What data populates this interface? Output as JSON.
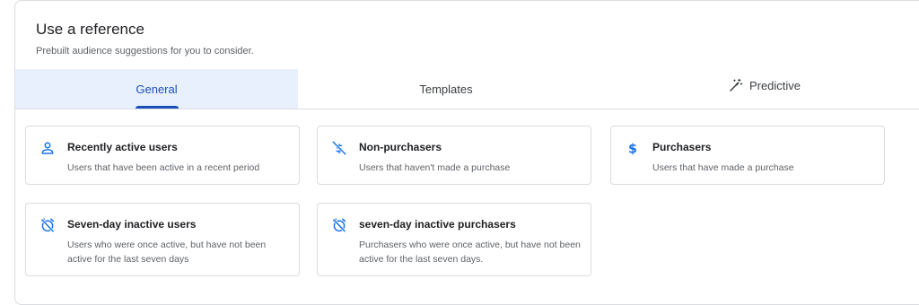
{
  "header": {
    "title": "Use a reference",
    "subtitle": "Prebuilt audience suggestions for you to consider."
  },
  "tabs": [
    {
      "label": "General",
      "active": true
    },
    {
      "label": "Templates",
      "active": false
    },
    {
      "label": "Predictive",
      "active": false,
      "icon": "magic-wand-icon"
    }
  ],
  "cards": [
    {
      "title": "Recently active users",
      "description": "Users that have been active in a recent period",
      "icon": "person-icon"
    },
    {
      "title": "Non-purchasers",
      "description": "Users that haven't made a purchase",
      "icon": "money-off-icon"
    },
    {
      "title": "Purchasers",
      "description": "Users that have made a purchase",
      "icon": "dollar-icon"
    },
    {
      "title": "Seven-day inactive users",
      "description": "Users who were once active, but have not been active for the last seven days",
      "icon": "alarm-off-icon"
    },
    {
      "title": "seven-day inactive purchasers",
      "description": "Purchasers who were once active, but have not been active for the last seven days.",
      "icon": "alarm-off-icon"
    }
  ],
  "colors": {
    "accent": "#1a73e8",
    "active_tab_bg": "#e8f0fe",
    "active_tab_text": "#1a4fb8"
  }
}
